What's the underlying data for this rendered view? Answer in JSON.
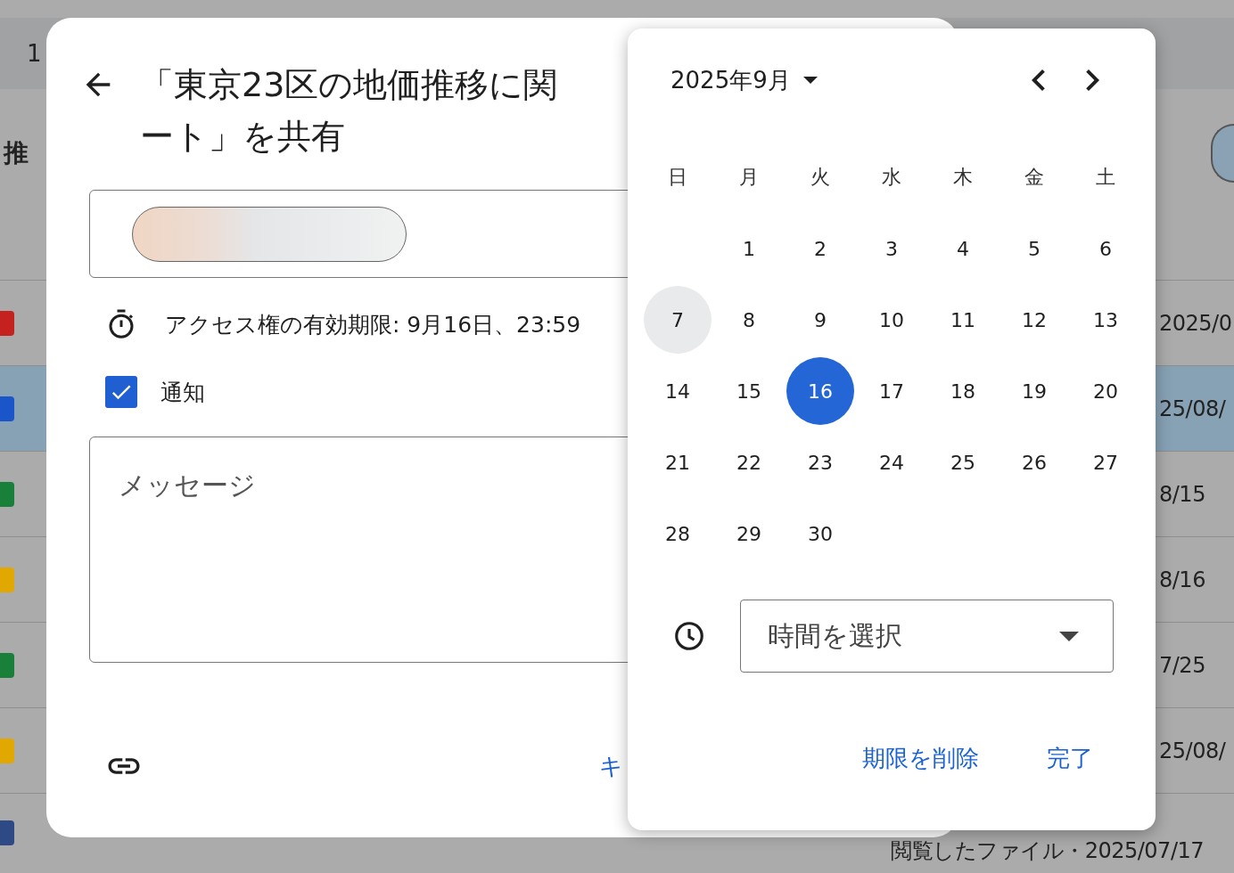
{
  "background": {
    "header_text": "1",
    "section_title": "推",
    "rows": [
      {
        "kind": "pdf",
        "selected": false,
        "date": "2025/0"
      },
      {
        "kind": "doc",
        "selected": true,
        "date": "25/08/"
      },
      {
        "kind": "sheet",
        "selected": false,
        "date": "8/15"
      },
      {
        "kind": "slide",
        "selected": false,
        "date": "8/16"
      },
      {
        "kind": "sheet",
        "selected": false,
        "date": "7/25"
      },
      {
        "kind": "slide",
        "selected": false,
        "date": "25/08/"
      },
      {
        "kind": "form",
        "selected": false,
        "date": "閲覧したファイル・2025/07/17"
      }
    ]
  },
  "dialog": {
    "title_lines": [
      "「東京23区の地価推移に関",
      "ート」を共有"
    ],
    "expiry": "アクセス権の有効期限: 9月16日、23:59",
    "notify": {
      "label": "通知",
      "checked": true
    },
    "message": {
      "placeholder": "メッセージ"
    },
    "cancel_button": "キ"
  },
  "calendar": {
    "month": "2025年9月",
    "weekdays": [
      "日",
      "月",
      "火",
      "水",
      "木",
      "金",
      "土"
    ],
    "weeks": [
      [
        {
          "day": "1",
          "selected": false,
          "today": false
        },
        {
          "day": "2",
          "selected": false,
          "today": false
        },
        {
          "day": "3",
          "selected": false,
          "today": false
        },
        {
          "day": "4",
          "selected": false,
          "today": false
        },
        {
          "day": "5",
          "selected": false,
          "today": false
        },
        {
          "day": "6",
          "selected": false,
          "today": false
        }
      ],
      [
        {
          "day": "7",
          "selected": false,
          "today": true
        },
        {
          "day": "8",
          "selected": false,
          "today": false
        },
        {
          "day": "9",
          "selected": false,
          "today": false
        },
        {
          "day": "10",
          "selected": false,
          "today": false
        },
        {
          "day": "11",
          "selected": false,
          "today": false
        },
        {
          "day": "12",
          "selected": false,
          "today": false
        },
        {
          "day": "13",
          "selected": false,
          "today": false
        }
      ],
      [
        {
          "day": "14",
          "selected": false,
          "today": false
        },
        {
          "day": "15",
          "selected": false,
          "today": false
        },
        {
          "day": "16",
          "selected": true,
          "today": false
        },
        {
          "day": "17",
          "selected": false,
          "today": false
        },
        {
          "day": "18",
          "selected": false,
          "today": false
        },
        {
          "day": "19",
          "selected": false,
          "today": false
        },
        {
          "day": "20",
          "selected": false,
          "today": false
        }
      ],
      [
        {
          "day": "21",
          "selected": false,
          "today": false
        },
        {
          "day": "22",
          "selected": false,
          "today": false
        },
        {
          "day": "23",
          "selected": false,
          "today": false
        },
        {
          "day": "24",
          "selected": false,
          "today": false
        },
        {
          "day": "25",
          "selected": false,
          "today": false
        },
        {
          "day": "26",
          "selected": false,
          "today": false
        },
        {
          "day": "27",
          "selected": false,
          "today": false
        }
      ],
      [
        {
          "day": "28",
          "selected": false,
          "today": false
        },
        {
          "day": "29",
          "selected": false,
          "today": false
        },
        {
          "day": "30",
          "selected": false,
          "today": false
        }
      ]
    ],
    "time_select": {
      "placeholder": "時間を選択"
    },
    "buttons": [
      "期限を削除",
      "完了"
    ]
  }
}
